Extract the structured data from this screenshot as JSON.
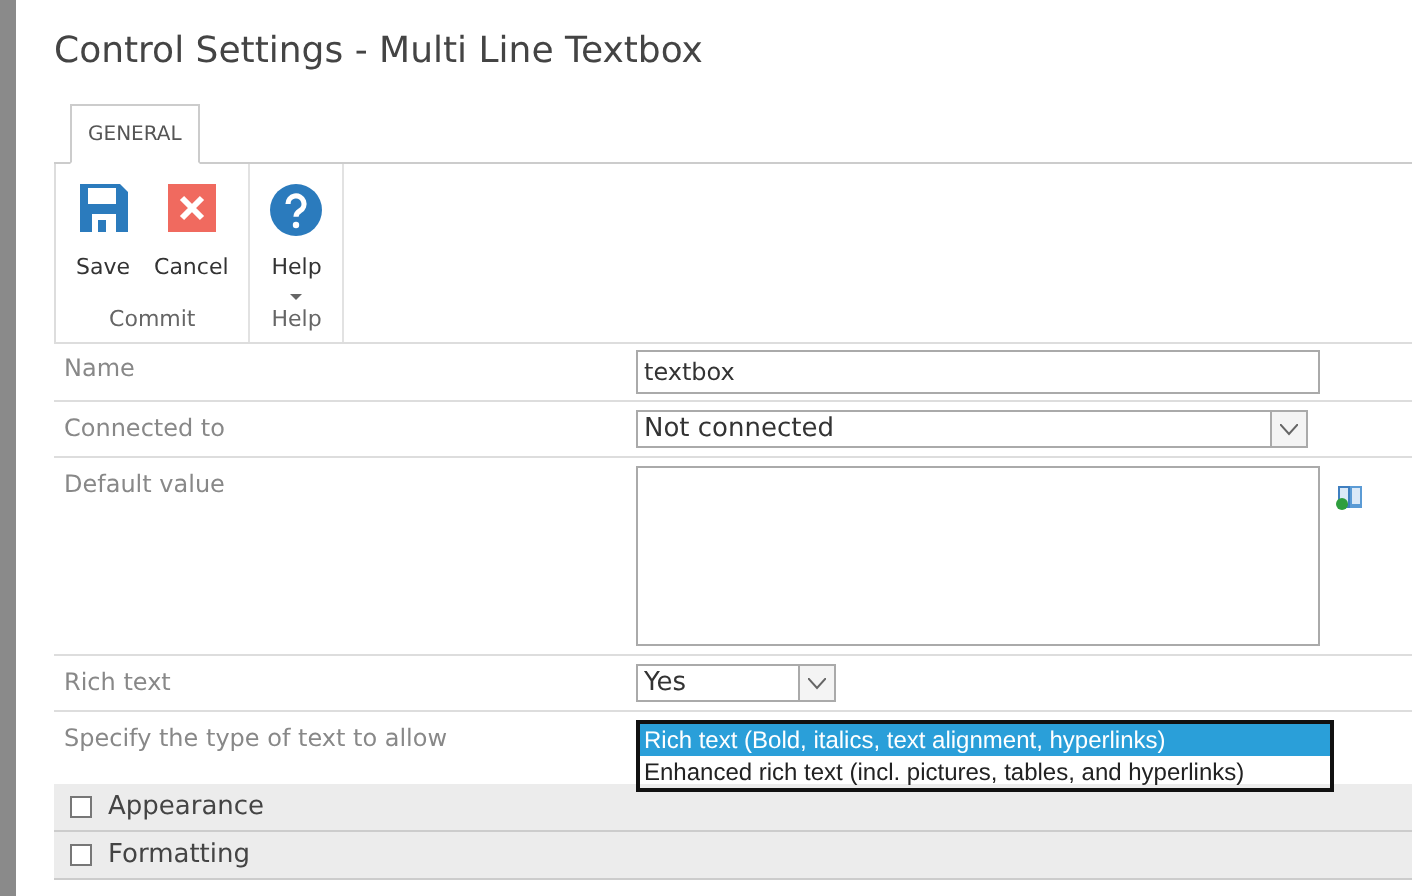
{
  "window": {
    "title": "Control Settings - Multi Line Textbox"
  },
  "tabs": [
    {
      "label": "GENERAL",
      "selected": true
    }
  ],
  "ribbon": {
    "groups": [
      {
        "label": "Commit",
        "buttons": [
          {
            "label": "Save",
            "kind": "save"
          },
          {
            "label": "Cancel",
            "kind": "cancel"
          }
        ]
      },
      {
        "label": "Help",
        "buttons": [
          {
            "label": "Help",
            "kind": "help",
            "dropdown": true
          }
        ]
      }
    ]
  },
  "fields": [
    {
      "label": "Name",
      "kind": "text",
      "value": "textbox"
    },
    {
      "label": "Connected to",
      "kind": "select",
      "value": "Not connected"
    },
    {
      "label": "Default value",
      "kind": "textarea",
      "lookup": true
    },
    {
      "label": "Rich text",
      "kind": "select-small",
      "value": "Yes"
    },
    {
      "label": "Specify the type of text to allow",
      "kind": "listbox",
      "options": [
        {
          "label": "Rich text (Bold, italics, text alignment, hyperlinks)",
          "selected": true
        },
        {
          "label": "Enhanced rich text (incl. pictures, tables, and hyperlinks)",
          "selected": false
        }
      ]
    }
  ],
  "sections": [
    {
      "label": "Appearance"
    },
    {
      "label": "Formatting"
    }
  ]
}
